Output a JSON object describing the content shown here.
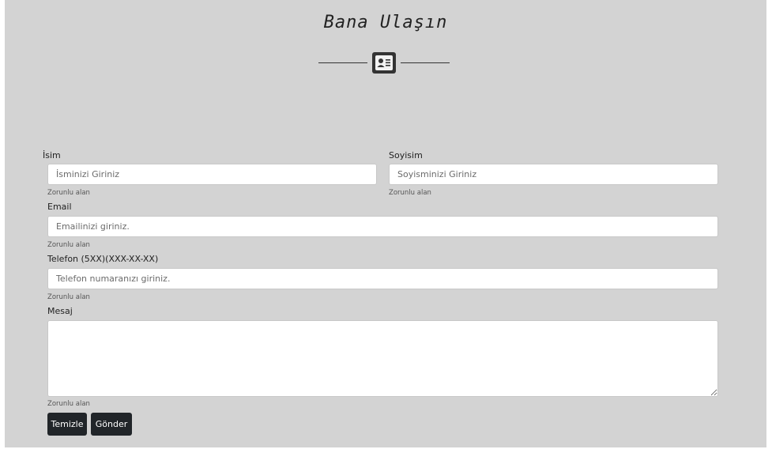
{
  "header": {
    "title": "Bana Ulaşın",
    "icon": "contact-card-icon"
  },
  "form": {
    "first_name": {
      "label": "İsim",
      "placeholder": "İsminizi Giriniz",
      "value": "",
      "hint": "Zorunlu alan"
    },
    "last_name": {
      "label": "Soyisim",
      "placeholder": "Soyisminizi Giriniz",
      "value": "",
      "hint": "Zorunlu alan"
    },
    "email": {
      "label": "Email",
      "placeholder": "Emailinizi giriniz.",
      "value": "",
      "hint": "Zorunlu alan"
    },
    "phone": {
      "label": "Telefon (5XX)(XXX-XX-XX)",
      "placeholder": "Telefon numaranızı giriniz.",
      "value": "",
      "hint": "Zorunlu alan"
    },
    "message": {
      "label": "Mesaj",
      "placeholder": "",
      "value": "",
      "hint": "Zorunlu alan"
    },
    "buttons": {
      "reset_label": "Temizle",
      "submit_label": "Gönder"
    }
  },
  "colors": {
    "background": "#d3d3d3",
    "button": "#212529",
    "button_text": "#ffffff",
    "input_background": "#ffffff"
  }
}
